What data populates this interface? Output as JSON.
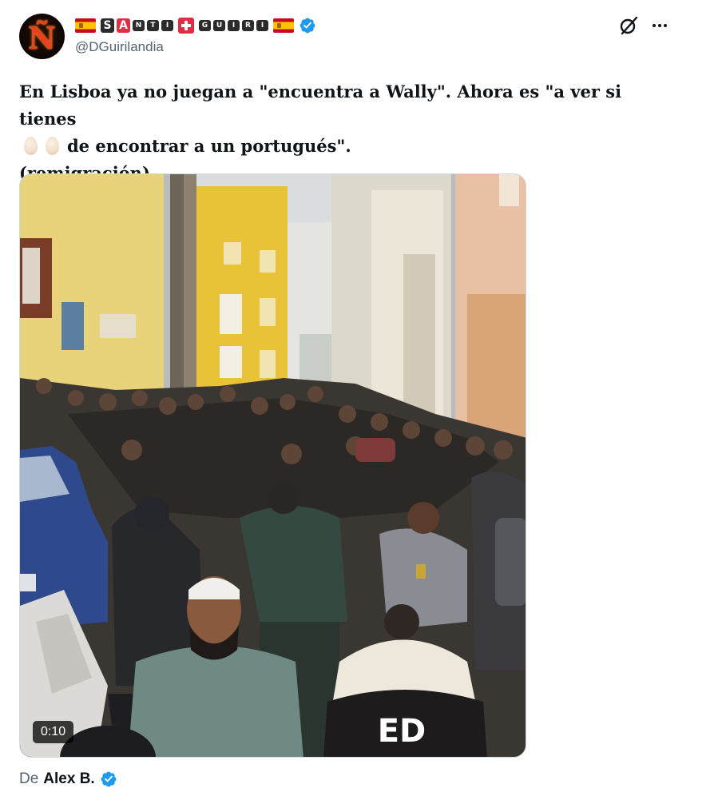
{
  "author": {
    "avatar_letter": "Ñ",
    "display_name_letters": [
      "S",
      "A",
      "N",
      "T",
      "I",
      "G",
      "U",
      "I",
      "R",
      "I"
    ],
    "handle": "@DGuirilandia",
    "verified": true
  },
  "tweet": {
    "line1": "En Lisboa ya no juegan a \"encuentra a Wally\". Ahora es \"a ver si tienes",
    "line2_after_eggs": "de encontrar a un portugués\".",
    "line3": "(remigración)"
  },
  "media": {
    "duration": "0:10",
    "jersey_text": "ED"
  },
  "attribution": {
    "prefix": "De",
    "name": "Alex B.",
    "verified": true
  },
  "icons": {
    "grok": "grok-icon",
    "more": "more-icon",
    "verified": "verified-badge-icon",
    "egg": "egg-emoji-icon",
    "flag": "spain-flag-icon",
    "cross": "swiss-cross-icon"
  },
  "colors": {
    "verified_blue": "#1d9bf0",
    "text_primary": "#0f1419",
    "text_secondary": "#536471"
  }
}
